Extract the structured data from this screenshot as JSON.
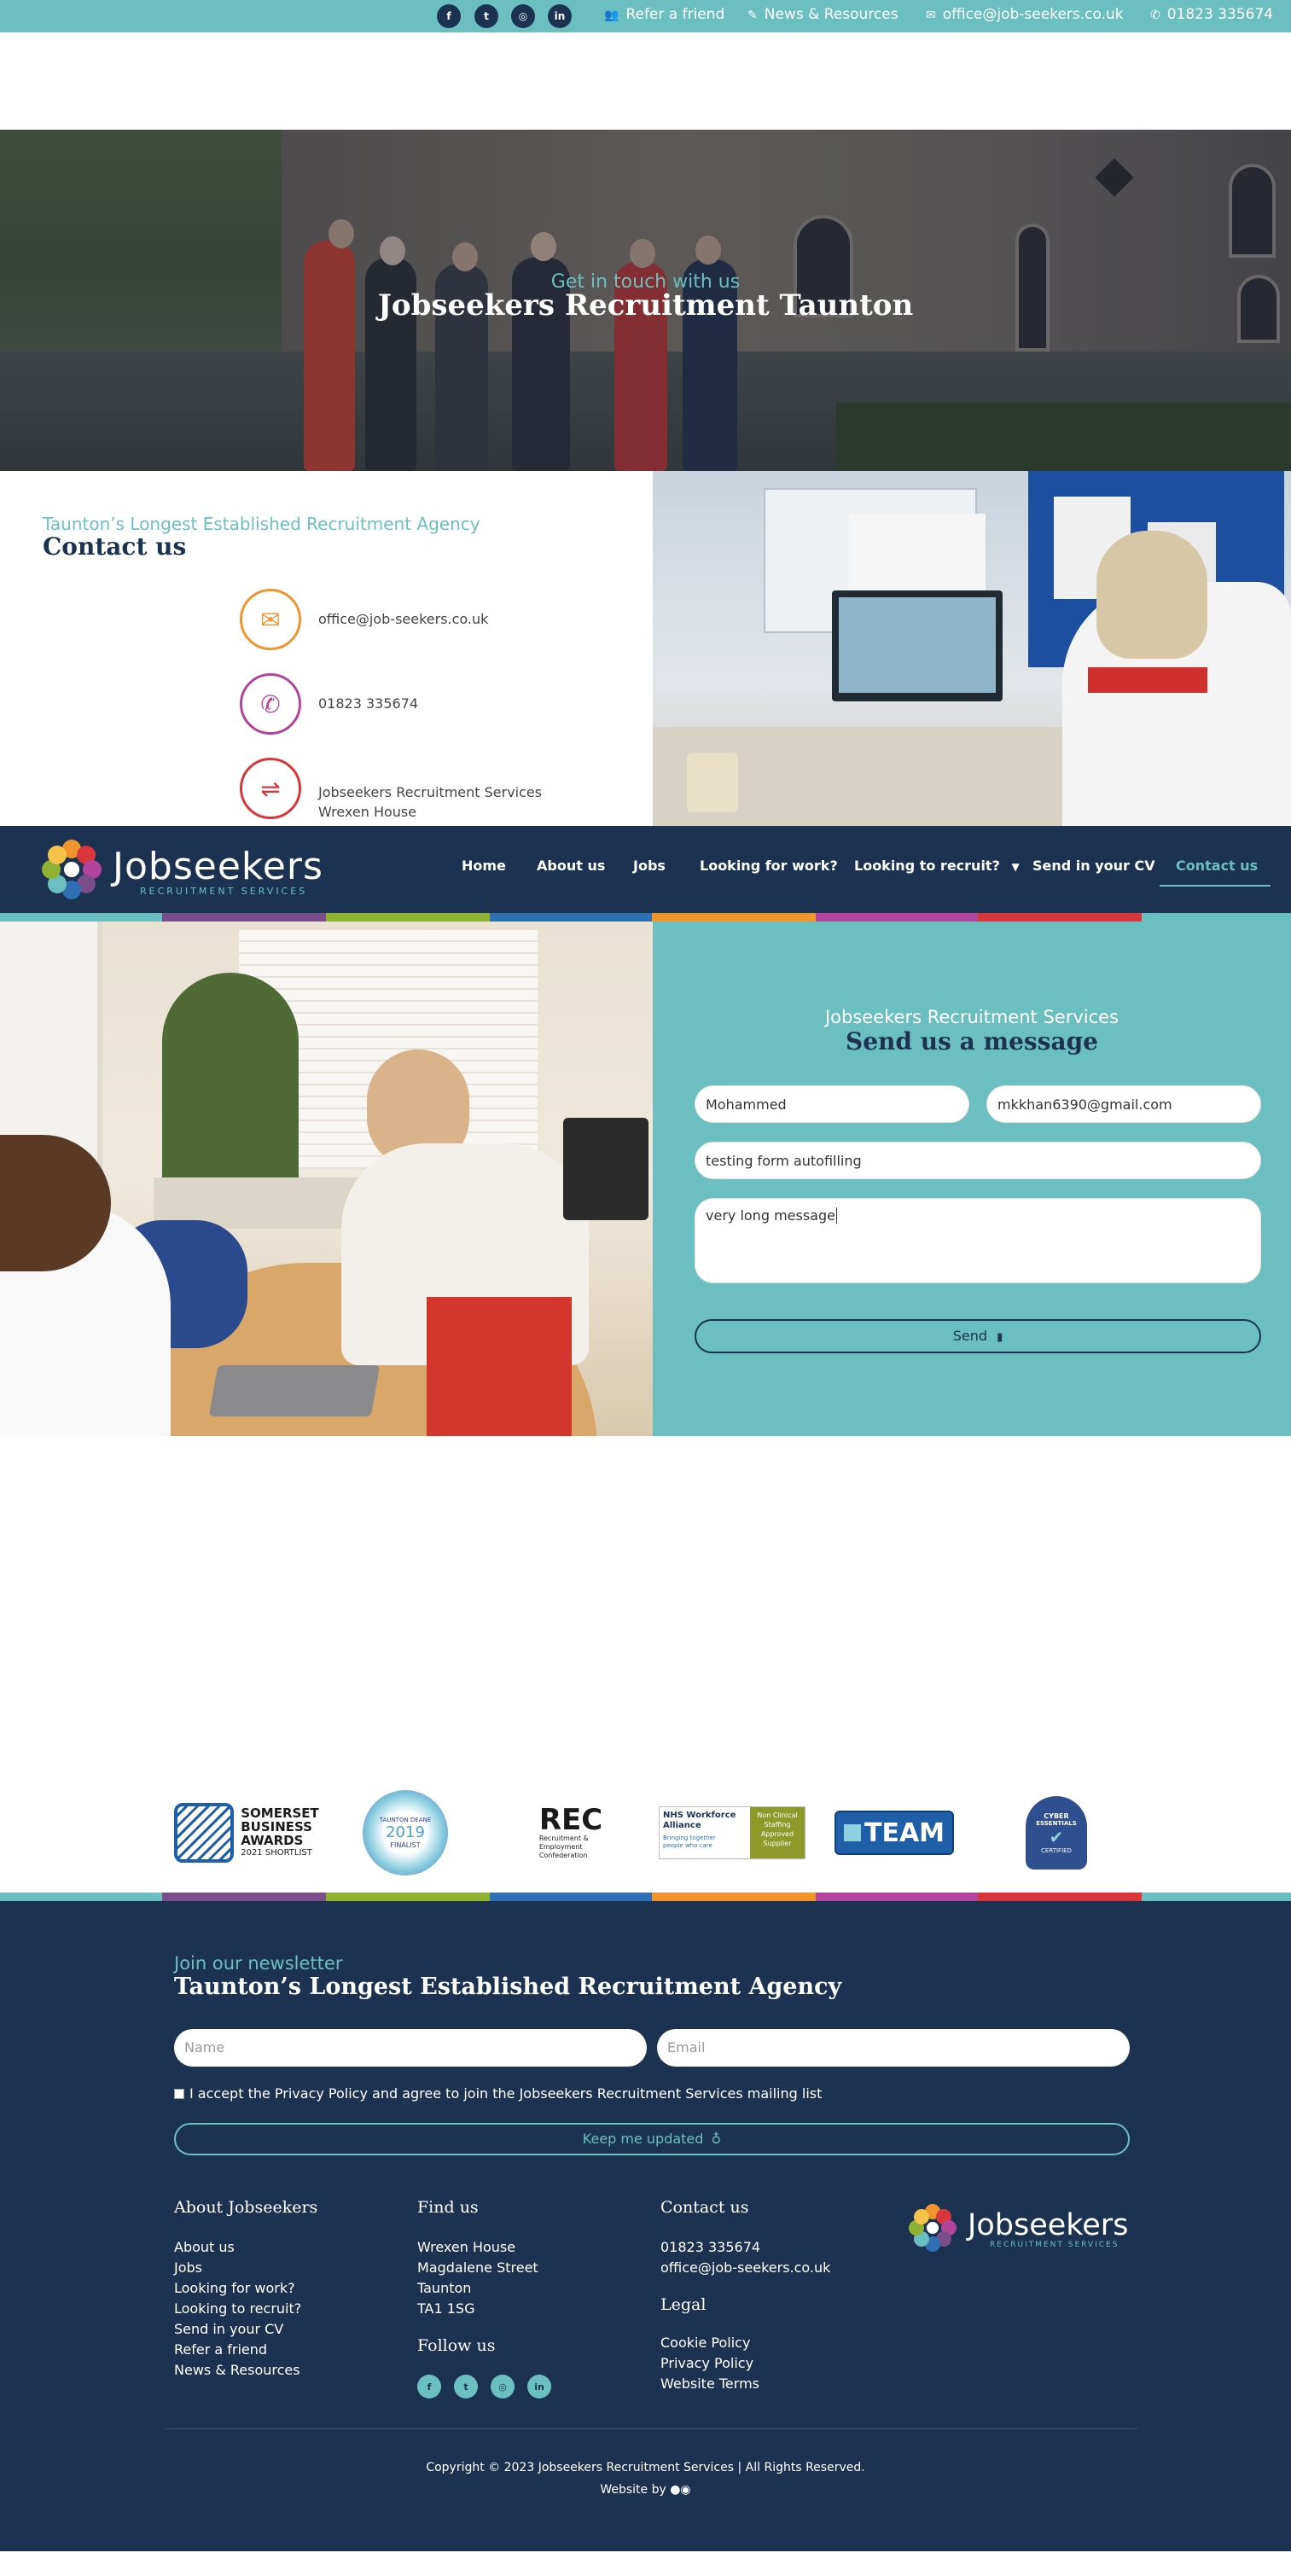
{
  "topbar": {
    "social": [
      {
        "icon": "facebook-icon",
        "glyph": "f"
      },
      {
        "icon": "twitter-icon",
        "glyph": "t"
      },
      {
        "icon": "instagram-icon",
        "glyph": "◎"
      },
      {
        "icon": "linkedin-icon",
        "glyph": "in"
      }
    ],
    "refer_label": "Refer a friend",
    "news_label": "News & Resources",
    "email_label": "office@job-seekers.co.uk",
    "phone_label": "01823 335674"
  },
  "hero": {
    "subtitle": "Get in touch with us",
    "title": "Jobseekers Recruitment Taunton"
  },
  "contact": {
    "tagline": "Taunton’s Longest Established Recruitment Agency",
    "heading": "Contact us",
    "email": "office@job-seekers.co.uk",
    "phone": "01823 335674",
    "address_line1": "Jobseekers Recruitment Services",
    "address_line2": "Wrexen House"
  },
  "nav": {
    "logo_name": "Jobseekers",
    "logo_sub": "RECRUITMENT SERVICES",
    "items": [
      "Home",
      "About us",
      "Jobs",
      "Looking for work?",
      "Looking to recruit?",
      "Send in your CV",
      "Contact us"
    ],
    "active": "Contact us"
  },
  "form": {
    "tagline": "Jobseekers Recruitment Services",
    "heading": "Send us a message",
    "name_value": "Mohammed",
    "email_value": "mkkhan6390@gmail.com",
    "subject_value": "testing form autofilling",
    "message_value": "very long message",
    "send_label": "Send"
  },
  "accreditations": {
    "somerset_line1": "SOMERSET",
    "somerset_line2": "BUSINESS",
    "somerset_line3": "AWARDS",
    "somerset_line4": "2021 SHORTLIST",
    "taunton_top": "TAUNTON DEANE",
    "taunton_year": "2019",
    "taunton_finalist": "FINALIST",
    "rec_letters": "REC",
    "rec_line1": "Recruitment &",
    "rec_line2": "Employment",
    "rec_line3": "Confederation",
    "nhs_line1": "NHS Workforce",
    "nhs_line2": "Alliance",
    "nhs_line3": "Bringing together",
    "nhs_line4": "people who care",
    "nhs_right1": "Non Clinical",
    "nhs_right2": "Staffing",
    "nhs_right3": "Approved",
    "nhs_right4": "Supplier",
    "team_label": "TEAM",
    "cyber_line1": "CYBER",
    "cyber_line2": "ESSENTIALS",
    "cyber_line3": "CERTIFIED"
  },
  "newsletter": {
    "tagline": "Join our newsletter",
    "heading": "Taunton’s Longest Established Recruitment Agency",
    "name_placeholder": "Name",
    "email_placeholder": "Email",
    "consent": "I accept the Privacy Policy and agree to join the Jobseekers Recruitment Services mailing list",
    "button": "Keep me updated"
  },
  "footer": {
    "about_heading": "About Jobseekers",
    "about_links": [
      "About us",
      "Jobs",
      "Looking for work?",
      "Looking to recruit?",
      "Send in your CV",
      "Refer a friend",
      "News & Resources"
    ],
    "find_heading": "Find us",
    "address": [
      "Wrexen House",
      "Magdalene Street",
      "Taunton",
      "TA1 1SG"
    ],
    "follow_heading": "Follow us",
    "contact_heading": "Contact us",
    "contact_lines": [
      "01823 335674",
      "office@job-seekers.co.uk"
    ],
    "legal_heading": "Legal",
    "legal_links": [
      "Cookie Policy",
      "Privacy Policy",
      "Website Terms"
    ],
    "logo_name": "Jobseekers",
    "logo_sub": "RECRUITMENT SERVICES",
    "copyright": "Copyright © 2023 Jobseekers Recruitment Services | All Rights Reserved.",
    "website_by": "Website by"
  },
  "colors": {
    "teal": "#6bbfc0",
    "navy": "#1b3350",
    "stripe": [
      "#6bbfc0",
      "#7a4e8a",
      "#8fb232",
      "#2f6fb3",
      "#f0952e",
      "#b2459b",
      "#d8363b",
      "#6bbfc0"
    ]
  }
}
